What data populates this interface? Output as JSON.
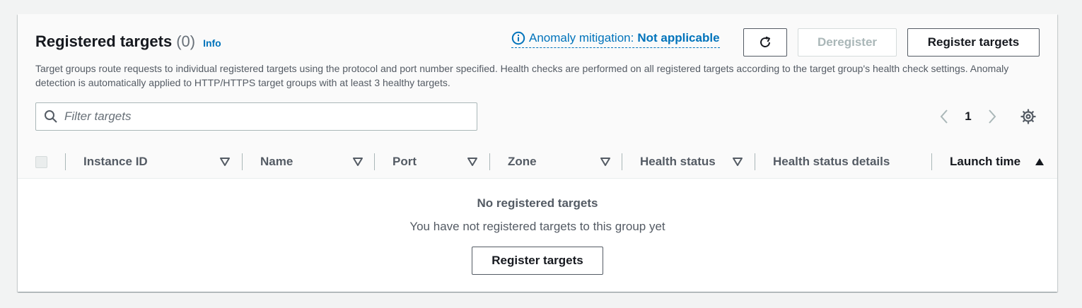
{
  "header": {
    "title": "Registered targets",
    "count": "(0)",
    "info_link": "Info",
    "description": "Target groups route requests to individual registered targets using the protocol and port number specified. Health checks are performed on all registered targets according to the target group's health check settings. Anomaly detection is automatically applied to HTTP/HTTPS target groups with at least 3 healthy targets."
  },
  "anomaly": {
    "label": "Anomaly mitigation:",
    "status": "Not applicable",
    "icon": "info-circle-icon"
  },
  "actions": {
    "refresh_icon": "refresh-icon",
    "deregister_label": "Deregister",
    "register_label": "Register targets"
  },
  "filter": {
    "placeholder": "Filter targets",
    "icon": "search-icon"
  },
  "pagination": {
    "current_page": "1",
    "prev_icon": "chevron-left-icon",
    "next_icon": "chevron-right-icon",
    "settings_icon": "gear-icon"
  },
  "table": {
    "columns": [
      {
        "label": "Instance ID",
        "sort": "filter"
      },
      {
        "label": "Name",
        "sort": "filter"
      },
      {
        "label": "Port",
        "sort": "filter"
      },
      {
        "label": "Zone",
        "sort": "filter"
      },
      {
        "label": "Health status",
        "sort": "filter"
      },
      {
        "label": "Health status details",
        "sort": "none"
      },
      {
        "label": "Launch time",
        "sort": "ascending"
      }
    ]
  },
  "empty_state": {
    "title": "No registered targets",
    "description": "You have not registered targets to this group yet",
    "button_label": "Register targets"
  },
  "colors": {
    "link": "#0073bb",
    "header_bg": "#fafafa",
    "page_bg": "#f2f3f3",
    "text_primary": "#16191f",
    "text_secondary": "#545b64"
  }
}
